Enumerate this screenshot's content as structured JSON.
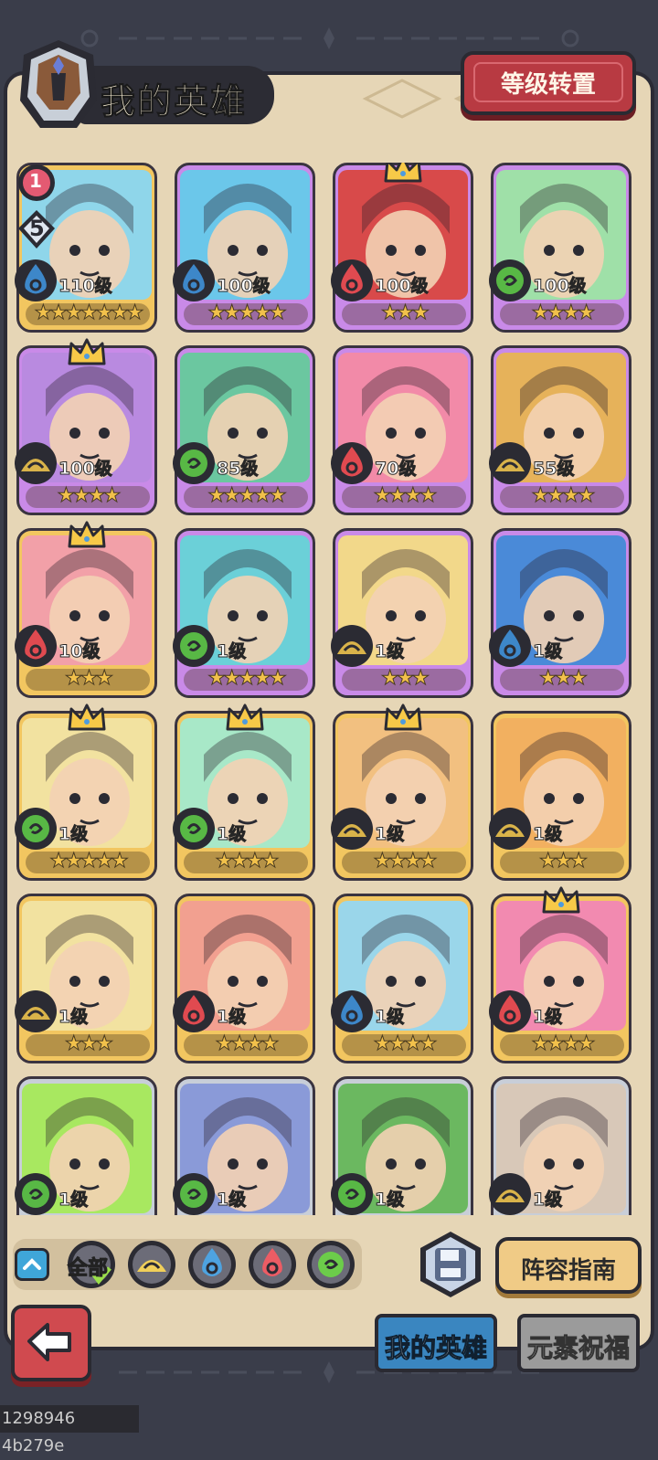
{
  "header": {
    "title": "我的英雄",
    "rank_transfer_button": "等级转置"
  },
  "badges": {
    "top_badge": "1",
    "second_badge": "5"
  },
  "colors": {
    "panel": "#e6d6b6",
    "gold_frame": "#f2c660",
    "purple_frame": "#c98ae8",
    "water": "#3d87c9",
    "fire": "#e04a50",
    "wind": "#58b845",
    "earth": "#d9b34a"
  },
  "heroes": [
    {
      "level": "110级",
      "stars": "★★★★★★★",
      "element": "water",
      "rarity": "gold",
      "crown": false,
      "art": "#8fd6ea"
    },
    {
      "level": "100级",
      "stars": "★★★★★",
      "element": "water",
      "rarity": "purple",
      "crown": false,
      "art": "#6bc7ea"
    },
    {
      "level": "100级",
      "stars": "★★★",
      "element": "fire",
      "rarity": "purple",
      "crown": true,
      "art": "#d84a4a"
    },
    {
      "level": "100级",
      "stars": "★★★★",
      "element": "wind",
      "rarity": "purple",
      "crown": false,
      "art": "#9fe0a8"
    },
    {
      "level": "100级",
      "stars": "★★★★",
      "element": "earth",
      "rarity": "purple",
      "crown": true,
      "art": "#b98ae0"
    },
    {
      "level": "85级",
      "stars": "★★★★★",
      "element": "wind",
      "rarity": "purple",
      "crown": false,
      "art": "#6bc7a0"
    },
    {
      "level": "70级",
      "stars": "★★★★",
      "element": "fire",
      "rarity": "purple",
      "crown": false,
      "art": "#f28aa8"
    },
    {
      "level": "55级",
      "stars": "★★★★",
      "element": "earth",
      "rarity": "purple",
      "crown": false,
      "art": "#e6b25a"
    },
    {
      "level": "10级",
      "stars": "★★★",
      "element": "fire",
      "rarity": "gold",
      "crown": true,
      "art": "#f2a0a8"
    },
    {
      "level": "1级",
      "stars": "★★★★★",
      "element": "wind",
      "rarity": "purple",
      "crown": false,
      "art": "#6bd0d8"
    },
    {
      "level": "1级",
      "stars": "★★★",
      "element": "earth",
      "rarity": "purple",
      "crown": false,
      "art": "#f2d88a"
    },
    {
      "level": "1级",
      "stars": "★★★",
      "element": "water",
      "rarity": "purple",
      "crown": false,
      "art": "#4a8ad8"
    },
    {
      "level": "1级",
      "stars": "★★★★★",
      "element": "wind",
      "rarity": "gold",
      "crown": true,
      "art": "#f2e2a0"
    },
    {
      "level": "1级",
      "stars": "★★★★",
      "element": "wind",
      "rarity": "gold",
      "crown": true,
      "art": "#a8e8c8"
    },
    {
      "level": "1级",
      "stars": "★★★★",
      "element": "earth",
      "rarity": "gold",
      "crown": true,
      "art": "#f2c080"
    },
    {
      "level": "1级",
      "stars": "★★★",
      "element": "earth",
      "rarity": "gold",
      "crown": false,
      "art": "#f2b060"
    },
    {
      "level": "1级",
      "stars": "★★★",
      "element": "earth",
      "rarity": "gold",
      "crown": false,
      "art": "#f2e2a0"
    },
    {
      "level": "1级",
      "stars": "★★★★",
      "element": "fire",
      "rarity": "gold",
      "crown": false,
      "art": "#f2a090"
    },
    {
      "level": "1级",
      "stars": "★★★★",
      "element": "water",
      "rarity": "gold",
      "crown": false,
      "art": "#9ad6ea"
    },
    {
      "level": "1级",
      "stars": "★★★★",
      "element": "fire",
      "rarity": "gold",
      "crown": true,
      "art": "#f28ab0"
    },
    {
      "level": "1级",
      "stars": "★★★",
      "element": "wind",
      "rarity": "silver",
      "crown": false,
      "art": "#a8e860"
    },
    {
      "level": "1级",
      "stars": "★★★",
      "element": "wind",
      "rarity": "silver",
      "crown": false,
      "art": "#8a9ad8"
    },
    {
      "level": "1级",
      "stars": "★★★",
      "element": "wind",
      "rarity": "silver",
      "crown": false,
      "art": "#6bb860"
    },
    {
      "level": "1级",
      "stars": "★★★",
      "element": "earth",
      "rarity": "silver",
      "crown": false,
      "art": "#d8c8b8"
    }
  ],
  "filters": {
    "all_label": "全部",
    "elements": [
      "earth-icon",
      "water-icon",
      "fire-icon",
      "wind-icon"
    ]
  },
  "buttons": {
    "guide": "阵容指南"
  },
  "tabs": {
    "my_heroes": "我的英雄",
    "element_blessing": "元素祝福"
  },
  "footer": {
    "id_text": "1298946 4b279e"
  }
}
